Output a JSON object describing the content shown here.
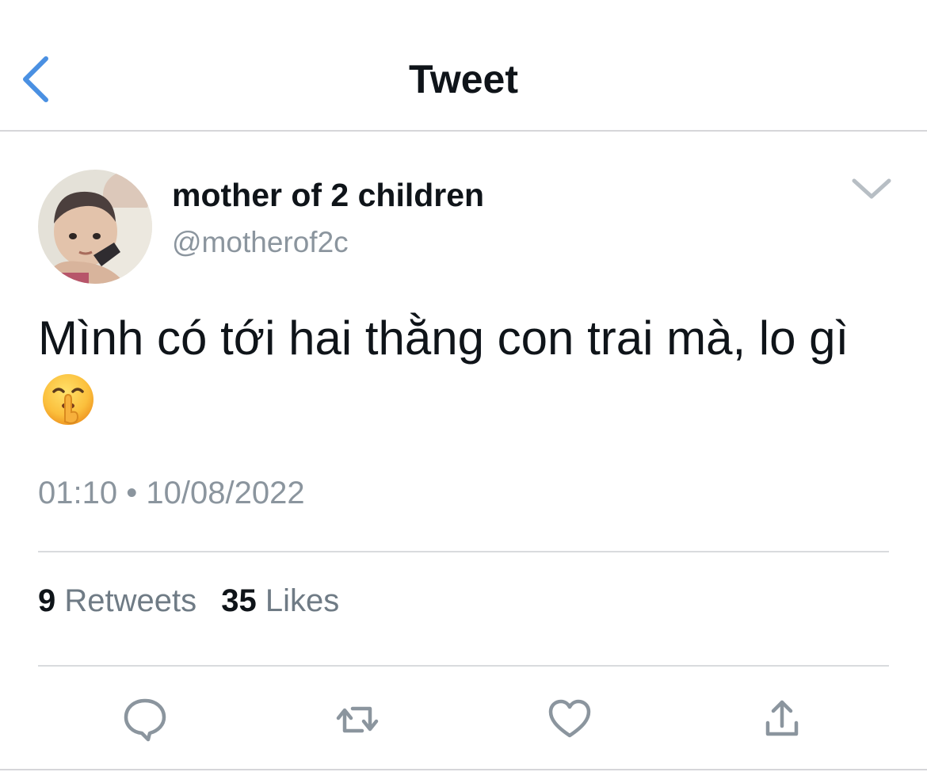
{
  "header": {
    "title": "Tweet",
    "back_icon": "chevron-left-icon",
    "accent_color": "#1d9bf0"
  },
  "author": {
    "display_name": "mother of 2 children",
    "handle": "@motherof2c",
    "avatar_icon": "profile-photo-avatar",
    "menu_icon": "chevron-down-icon"
  },
  "tweet": {
    "text": "Mình có tới hai thằng con trai mà, lo gì",
    "emoji": "shushing-face-emoji",
    "time": "01:10",
    "separator": "•",
    "date": "10/08/2022"
  },
  "stats": {
    "retweets_count": "9",
    "retweets_label": "Retweets",
    "likes_count": "35",
    "likes_label": "Likes"
  },
  "actions": [
    {
      "name": "reply",
      "icon": "speech-bubble-icon"
    },
    {
      "name": "retweet",
      "icon": "retweet-arrows-icon"
    },
    {
      "name": "like",
      "icon": "heart-icon"
    },
    {
      "name": "share",
      "icon": "share-upload-icon"
    }
  ],
  "colors": {
    "text_primary": "#0f1419",
    "text_secondary": "#8b959e",
    "icon_gray": "#8b959e",
    "divider": "#d9dbde"
  }
}
